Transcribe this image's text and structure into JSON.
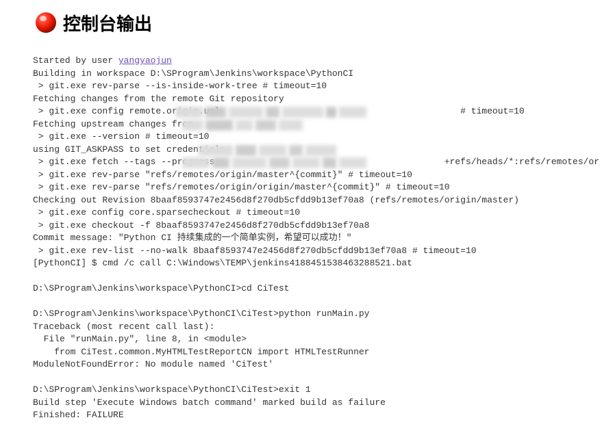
{
  "header": {
    "title": "控制台输出",
    "status": "failure"
  },
  "console": {
    "started_text": "Started by user ",
    "user_link": "yangyaojun",
    "lines_after_user": [
      "Building in workspace D:\\SProgram\\Jenkins\\workspace\\PythonCI",
      " > git.exe rev-parse --is-inside-work-tree # timeout=10",
      "Fetching changes from the remote Git repository"
    ],
    "line_config": " > git.exe config remote.origin.url                                             # timeout=10",
    "line_upstream": "Fetching upstream changes from ",
    "line_version": " > git.exe --version # timeout=10",
    "line_askpass": "using GIT_ASKPASS to set credentials ",
    "line_fetch": " > git.exe fetch --tags --progress                                           +refs/heads/*:refs/remotes/origin/*",
    "lines_rest": [
      " > git.exe rev-parse \"refs/remotes/origin/master^{commit}\" # timeout=10",
      " > git.exe rev-parse \"refs/remotes/origin/origin/master^{commit}\" # timeout=10",
      "Checking out Revision 8baaf8593747e2456d8f270db5cfdd9b13ef70a8 (refs/remotes/origin/master)",
      " > git.exe config core.sparsecheckout # timeout=10",
      " > git.exe checkout -f 8baaf8593747e2456d8f270db5cfdd9b13ef70a8",
      "Commit message: \"Python CI 持续集成的一个简单实例，希望可以成功！\"",
      " > git.exe rev-list --no-walk 8baaf8593747e2456d8f270db5cfdd9b13ef70a8 # timeout=10",
      "[PythonCI] $ cmd /c call C:\\Windows\\TEMP\\jenkins4188451538463288521.bat",
      "",
      "D:\\SProgram\\Jenkins\\workspace\\PythonCI>cd CiTest",
      "",
      "D:\\SProgram\\Jenkins\\workspace\\PythonCI\\CiTest>python runMain.py",
      "Traceback (most recent call last):",
      "  File \"runMain.py\", line 8, in <module>",
      "    from CiTest.common.MyHTMLTestReportCN import HTMLTestRunner",
      "ModuleNotFoundError: No module named 'CiTest'",
      "",
      "D:\\SProgram\\Jenkins\\workspace\\PythonCI\\CiTest>exit 1",
      "Build step 'Execute Windows batch command' marked build as failure",
      "Finished: FAILURE"
    ]
  }
}
